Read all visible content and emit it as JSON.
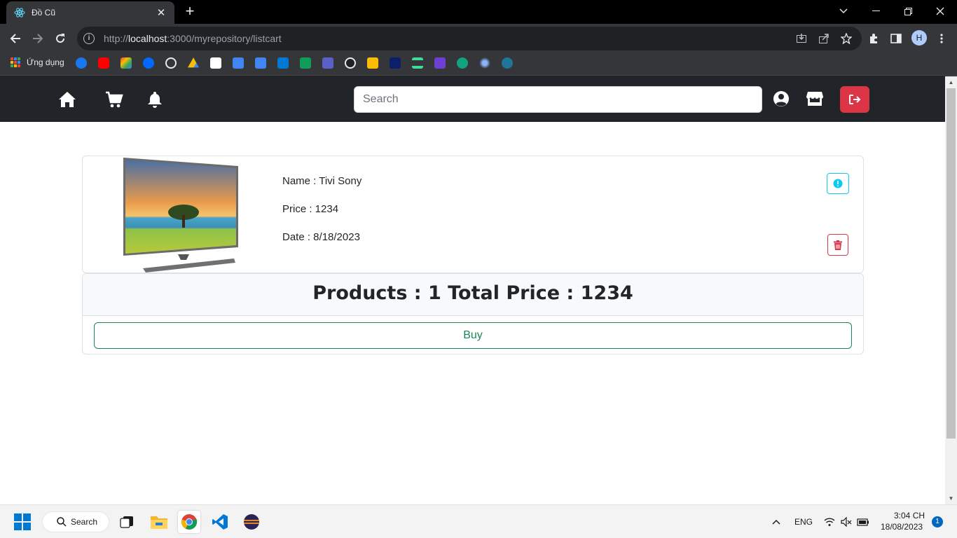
{
  "browser": {
    "tab_title": "Đồ Cũ",
    "url_prefix": "http://",
    "url_host": "localhost",
    "url_rest": ":3000/myrepository/listcart",
    "profile_initial": "H",
    "bookmarks_apps_label": "Ứng dụng"
  },
  "navbar": {
    "search_placeholder": "Search"
  },
  "cart": {
    "items": [
      {
        "name_line": "Name : Tivi Sony",
        "price_line": "Price : 1234",
        "date_line": "Date : 8/18/2023"
      }
    ],
    "summary": "Products : 1 Total Price : 1234",
    "buy_label": "Buy"
  },
  "taskbar": {
    "search_label": "Search",
    "language": "ENG",
    "time": "3:04 CH",
    "date": "18/08/2023",
    "notification_count": "1"
  },
  "colors": {
    "navbar_bg": "#212529",
    "logout": "#dc3545",
    "info": "#0dcaf0",
    "danger": "#dc3545",
    "success": "#198754"
  }
}
